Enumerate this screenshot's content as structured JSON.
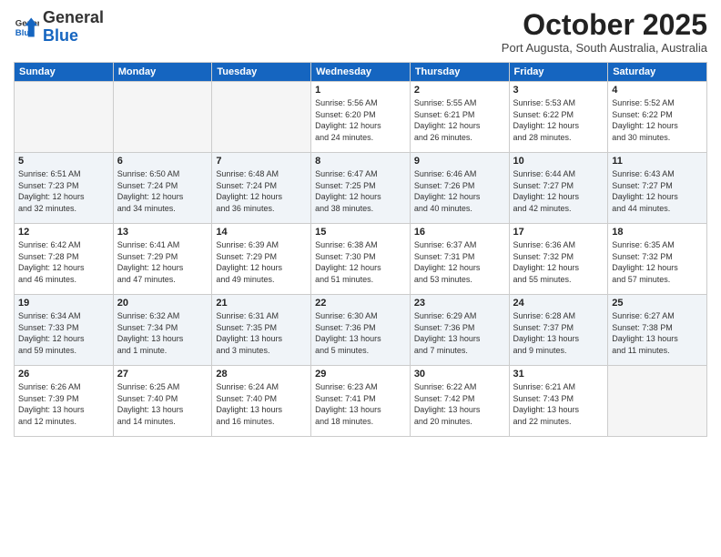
{
  "logo": {
    "line1": "General",
    "line2": "Blue"
  },
  "title": "October 2025",
  "subtitle": "Port Augusta, South Australia, Australia",
  "days_of_week": [
    "Sunday",
    "Monday",
    "Tuesday",
    "Wednesday",
    "Thursday",
    "Friday",
    "Saturday"
  ],
  "weeks": [
    [
      {
        "day": "",
        "info": ""
      },
      {
        "day": "",
        "info": ""
      },
      {
        "day": "",
        "info": ""
      },
      {
        "day": "1",
        "info": "Sunrise: 5:56 AM\nSunset: 6:20 PM\nDaylight: 12 hours\nand 24 minutes."
      },
      {
        "day": "2",
        "info": "Sunrise: 5:55 AM\nSunset: 6:21 PM\nDaylight: 12 hours\nand 26 minutes."
      },
      {
        "day": "3",
        "info": "Sunrise: 5:53 AM\nSunset: 6:22 PM\nDaylight: 12 hours\nand 28 minutes."
      },
      {
        "day": "4",
        "info": "Sunrise: 5:52 AM\nSunset: 6:22 PM\nDaylight: 12 hours\nand 30 minutes."
      }
    ],
    [
      {
        "day": "5",
        "info": "Sunrise: 6:51 AM\nSunset: 7:23 PM\nDaylight: 12 hours\nand 32 minutes."
      },
      {
        "day": "6",
        "info": "Sunrise: 6:50 AM\nSunset: 7:24 PM\nDaylight: 12 hours\nand 34 minutes."
      },
      {
        "day": "7",
        "info": "Sunrise: 6:48 AM\nSunset: 7:24 PM\nDaylight: 12 hours\nand 36 minutes."
      },
      {
        "day": "8",
        "info": "Sunrise: 6:47 AM\nSunset: 7:25 PM\nDaylight: 12 hours\nand 38 minutes."
      },
      {
        "day": "9",
        "info": "Sunrise: 6:46 AM\nSunset: 7:26 PM\nDaylight: 12 hours\nand 40 minutes."
      },
      {
        "day": "10",
        "info": "Sunrise: 6:44 AM\nSunset: 7:27 PM\nDaylight: 12 hours\nand 42 minutes."
      },
      {
        "day": "11",
        "info": "Sunrise: 6:43 AM\nSunset: 7:27 PM\nDaylight: 12 hours\nand 44 minutes."
      }
    ],
    [
      {
        "day": "12",
        "info": "Sunrise: 6:42 AM\nSunset: 7:28 PM\nDaylight: 12 hours\nand 46 minutes."
      },
      {
        "day": "13",
        "info": "Sunrise: 6:41 AM\nSunset: 7:29 PM\nDaylight: 12 hours\nand 47 minutes."
      },
      {
        "day": "14",
        "info": "Sunrise: 6:39 AM\nSunset: 7:29 PM\nDaylight: 12 hours\nand 49 minutes."
      },
      {
        "day": "15",
        "info": "Sunrise: 6:38 AM\nSunset: 7:30 PM\nDaylight: 12 hours\nand 51 minutes."
      },
      {
        "day": "16",
        "info": "Sunrise: 6:37 AM\nSunset: 7:31 PM\nDaylight: 12 hours\nand 53 minutes."
      },
      {
        "day": "17",
        "info": "Sunrise: 6:36 AM\nSunset: 7:32 PM\nDaylight: 12 hours\nand 55 minutes."
      },
      {
        "day": "18",
        "info": "Sunrise: 6:35 AM\nSunset: 7:32 PM\nDaylight: 12 hours\nand 57 minutes."
      }
    ],
    [
      {
        "day": "19",
        "info": "Sunrise: 6:34 AM\nSunset: 7:33 PM\nDaylight: 12 hours\nand 59 minutes."
      },
      {
        "day": "20",
        "info": "Sunrise: 6:32 AM\nSunset: 7:34 PM\nDaylight: 13 hours\nand 1 minute."
      },
      {
        "day": "21",
        "info": "Sunrise: 6:31 AM\nSunset: 7:35 PM\nDaylight: 13 hours\nand 3 minutes."
      },
      {
        "day": "22",
        "info": "Sunrise: 6:30 AM\nSunset: 7:36 PM\nDaylight: 13 hours\nand 5 minutes."
      },
      {
        "day": "23",
        "info": "Sunrise: 6:29 AM\nSunset: 7:36 PM\nDaylight: 13 hours\nand 7 minutes."
      },
      {
        "day": "24",
        "info": "Sunrise: 6:28 AM\nSunset: 7:37 PM\nDaylight: 13 hours\nand 9 minutes."
      },
      {
        "day": "25",
        "info": "Sunrise: 6:27 AM\nSunset: 7:38 PM\nDaylight: 13 hours\nand 11 minutes."
      }
    ],
    [
      {
        "day": "26",
        "info": "Sunrise: 6:26 AM\nSunset: 7:39 PM\nDaylight: 13 hours\nand 12 minutes."
      },
      {
        "day": "27",
        "info": "Sunrise: 6:25 AM\nSunset: 7:40 PM\nDaylight: 13 hours\nand 14 minutes."
      },
      {
        "day": "28",
        "info": "Sunrise: 6:24 AM\nSunset: 7:40 PM\nDaylight: 13 hours\nand 16 minutes."
      },
      {
        "day": "29",
        "info": "Sunrise: 6:23 AM\nSunset: 7:41 PM\nDaylight: 13 hours\nand 18 minutes."
      },
      {
        "day": "30",
        "info": "Sunrise: 6:22 AM\nSunset: 7:42 PM\nDaylight: 13 hours\nand 20 minutes."
      },
      {
        "day": "31",
        "info": "Sunrise: 6:21 AM\nSunset: 7:43 PM\nDaylight: 13 hours\nand 22 minutes."
      },
      {
        "day": "",
        "info": ""
      }
    ]
  ]
}
